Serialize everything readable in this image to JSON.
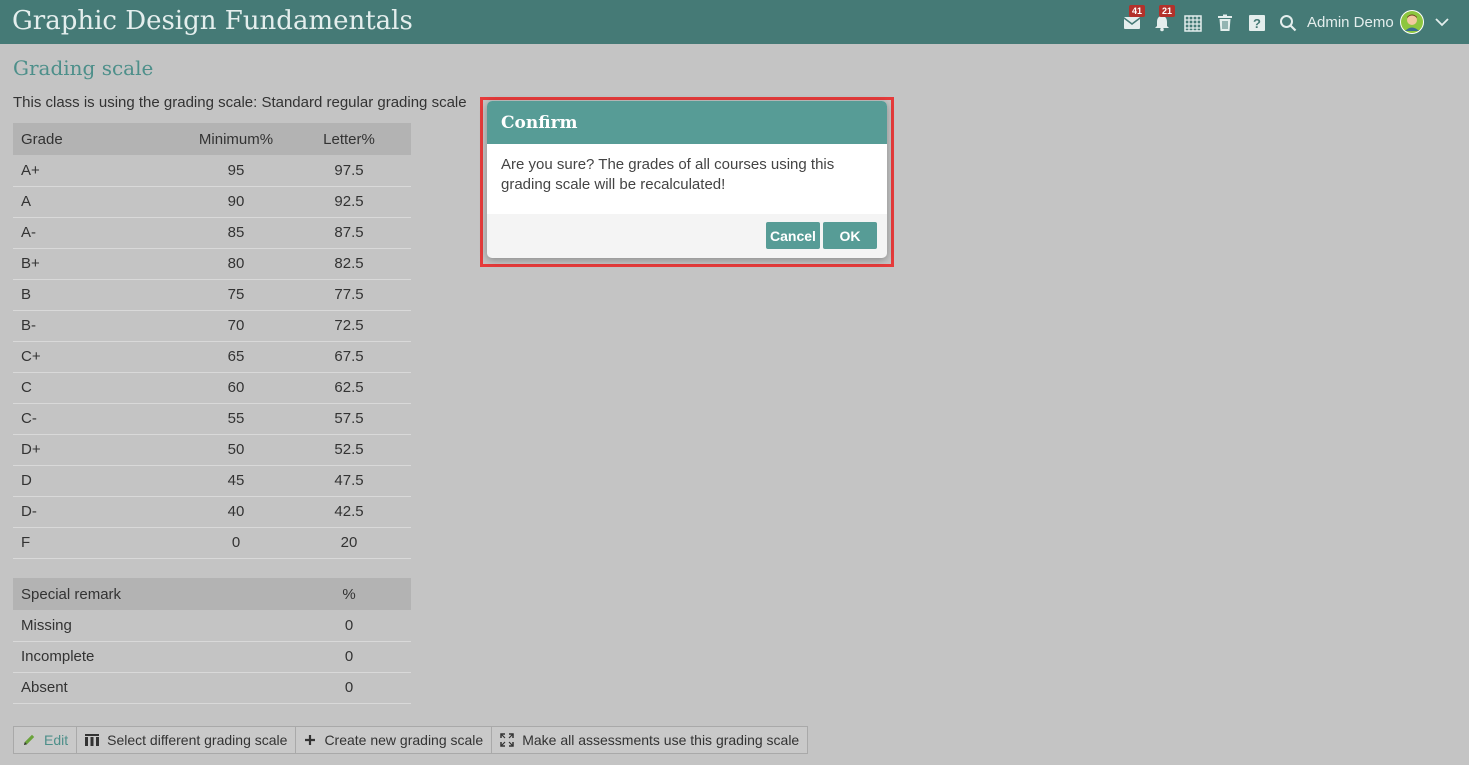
{
  "header": {
    "app_title": "Graphic Design Fundamentals",
    "messages_count": "41",
    "notifications_count": "21",
    "user_name": "Admin Demo"
  },
  "page": {
    "section_title": "Grading scale",
    "intro_text": "This class is using the grading scale: Standard regular grading scale"
  },
  "grades_table": {
    "headers": [
      "Grade",
      "Minimum%",
      "Letter%"
    ],
    "rows": [
      [
        "A+",
        "95",
        "97.5"
      ],
      [
        "A",
        "90",
        "92.5"
      ],
      [
        "A-",
        "85",
        "87.5"
      ],
      [
        "B+",
        "80",
        "82.5"
      ],
      [
        "B",
        "75",
        "77.5"
      ],
      [
        "B-",
        "70",
        "72.5"
      ],
      [
        "C+",
        "65",
        "67.5"
      ],
      [
        "C",
        "60",
        "62.5"
      ],
      [
        "C-",
        "55",
        "57.5"
      ],
      [
        "D+",
        "50",
        "52.5"
      ],
      [
        "D",
        "45",
        "47.5"
      ],
      [
        "D-",
        "40",
        "42.5"
      ],
      [
        "F",
        "0",
        "20"
      ]
    ]
  },
  "remarks_table": {
    "headers": [
      "Special remark",
      "%"
    ],
    "rows": [
      [
        "Missing",
        "0"
      ],
      [
        "Incomplete",
        "0"
      ],
      [
        "Absent",
        "0"
      ]
    ]
  },
  "actions": {
    "edit": "Edit",
    "select_scale": "Select different grading scale",
    "create_scale": "Create new grading scale",
    "apply_all": "Make all assessments use this grading scale"
  },
  "modal": {
    "title": "Confirm",
    "message": "Are you sure? The grades of all courses using this grading scale will be recalculated!",
    "cancel_label": "Cancel",
    "ok_label": "OK"
  },
  "colors": {
    "header_bg": "#457a76",
    "accent": "#579c96",
    "highlight": "#e63b3b",
    "badge": "#b3312b"
  },
  "icons": [
    "mail-icon",
    "bell-icon",
    "calendar-icon",
    "trash-icon",
    "help-icon",
    "search-icon",
    "avatar",
    "chevron-down-icon",
    "pencil-icon",
    "columns-icon",
    "plus-icon",
    "expand-icon"
  ]
}
